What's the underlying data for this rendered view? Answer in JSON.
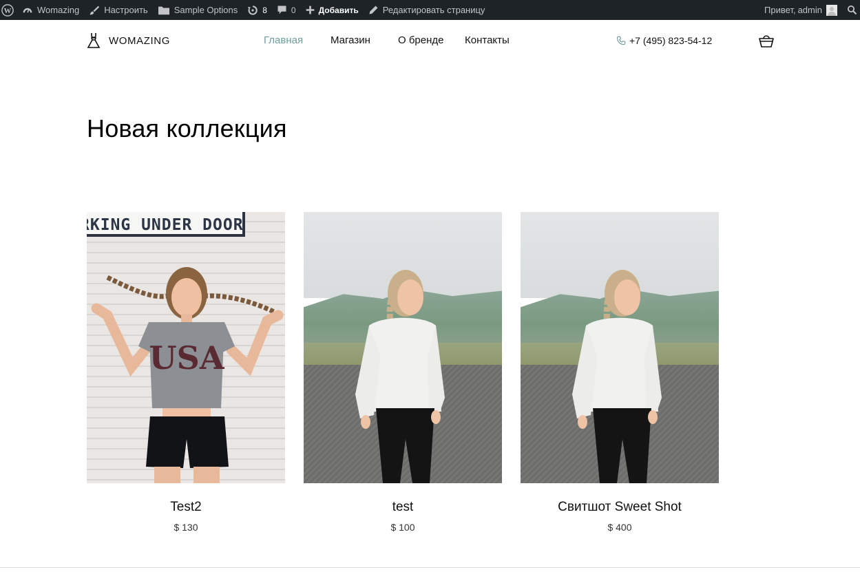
{
  "adminbar": {
    "site_name": "Womazing",
    "customize": "Настроить",
    "sample_options": "Sample Options",
    "updates_count": "8",
    "comments_count": "0",
    "add_new": "Добавить",
    "edit_page": "Редактировать страницу",
    "greeting": "Привет,",
    "username": "admin"
  },
  "header": {
    "logo": "WOMAZING",
    "nav": [
      {
        "label": "Главная",
        "active": true
      },
      {
        "label": "Магазин",
        "active": false
      },
      {
        "label": "О бренде",
        "active": false
      },
      {
        "label": "Контакты",
        "active": false
      }
    ],
    "phone": "+7 (495) 823-54-12",
    "accent_color": "#6e9c9f"
  },
  "main": {
    "title": "Новая коллекция",
    "products": [
      {
        "name": "Test2",
        "price": "$ 130",
        "photo_sign": "RKING UNDER DOOR",
        "shirt_print": "USA"
      },
      {
        "name": "test",
        "price": "$ 100"
      },
      {
        "name": "Свитшот Sweet Shot",
        "price": "$ 400"
      }
    ]
  },
  "icons": {
    "wp_logo": "wordpress-icon",
    "customize": "brush-icon",
    "options": "folder-icon",
    "updates": "refresh-icon",
    "comments": "comment-icon",
    "add": "plus-icon",
    "edit": "pencil-icon",
    "search": "search-icon",
    "logo": "dress-icon",
    "phone": "phone-icon",
    "cart": "basket-icon"
  }
}
